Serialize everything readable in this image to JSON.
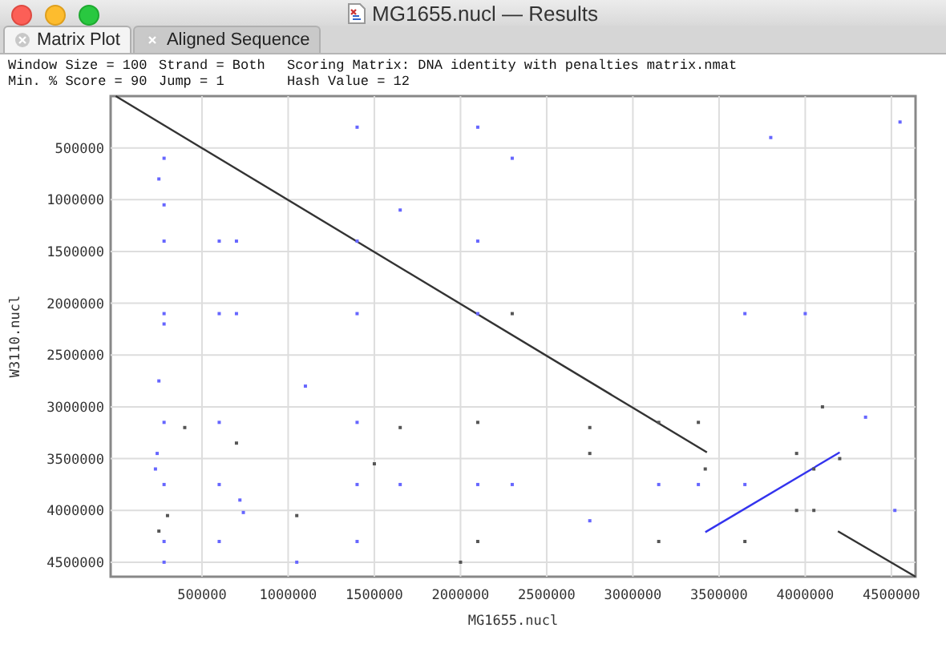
{
  "window": {
    "title": "MG1655.nucl — Results"
  },
  "tabs": [
    {
      "label": "Matrix Plot",
      "selected": true
    },
    {
      "label": "Aligned Sequence",
      "selected": false
    }
  ],
  "info": [
    {
      "text": "Window Size = 100"
    },
    {
      "text": "Strand = Both"
    },
    {
      "text": "Scoring Matrix: DNA identity with penalties matrix.nmat"
    },
    {
      "text": "Min. % Score = 90"
    },
    {
      "text": "Jump = 1"
    },
    {
      "text": "Hash Value = 12"
    }
  ],
  "chart_data": {
    "type": "line",
    "xlabel": "MG1655.nucl",
    "ylabel": "W3110.nucl",
    "xlim": [
      -30000,
      4640000
    ],
    "grid": true,
    "ylim": [
      4640000,
      0
    ],
    "xticks": [
      500000,
      1000000,
      1500000,
      2000000,
      2500000,
      3000000,
      3500000,
      4000000,
      4500000
    ],
    "yticks": [
      500000,
      1000000,
      1500000,
      2000000,
      2500000,
      3000000,
      3500000,
      4000000,
      4500000
    ],
    "series": [
      {
        "color": "#333333",
        "x": [
          0,
          3430000
        ],
        "values": [
          0,
          3440000
        ]
      },
      {
        "color": "#333333",
        "x": [
          4190000,
          4640000
        ],
        "values": [
          4200000,
          4640000
        ]
      },
      {
        "color": "#3333ee",
        "x": [
          3420000,
          4200000
        ],
        "values": [
          4210000,
          3440000
        ]
      },
      {
        "type": "scatter",
        "color": "#6666ff",
        "x": [
          280000,
          250000,
          280000,
          280000,
          280000,
          280000,
          250000,
          280000,
          240000,
          230000,
          280000,
          280000,
          280000,
          600000,
          600000,
          600000,
          720000,
          740000,
          600000,
          700000,
          600000,
          700000,
          1400000,
          1400000,
          1400000,
          1400000,
          1400000,
          1400000,
          1650000,
          1650000,
          1050000,
          1100000,
          2100000,
          2100000,
          2100000,
          2100000,
          2300000,
          2300000,
          2750000,
          3150000,
          3380000,
          3650000,
          3650000,
          4350000,
          4520000,
          4550000,
          3800000,
          4000000
        ],
        "values": [
          600000,
          800000,
          1050000,
          1400000,
          2100000,
          2200000,
          2750000,
          3150000,
          3450000,
          3600000,
          3750000,
          4300000,
          4500000,
          3150000,
          3750000,
          4300000,
          3900000,
          4020000,
          1400000,
          1400000,
          2100000,
          2100000,
          300000,
          1400000,
          2100000,
          3150000,
          3750000,
          4300000,
          1100000,
          3750000,
          4500000,
          2800000,
          300000,
          1400000,
          2100000,
          3750000,
          600000,
          3750000,
          4100000,
          3750000,
          3750000,
          2100000,
          3750000,
          3100000,
          4000000,
          250000,
          400000,
          2100000
        ]
      },
      {
        "type": "scatter",
        "color": "#555555",
        "x": [
          250000,
          300000,
          400000,
          700000,
          1500000,
          1650000,
          2100000,
          2100000,
          2300000,
          2750000,
          2750000,
          3150000,
          3150000,
          3380000,
          3420000,
          3650000,
          3950000,
          4050000,
          4200000,
          3950000,
          4050000,
          4100000,
          1050000,
          2000000
        ],
        "values": [
          4200000,
          4050000,
          3200000,
          3350000,
          3550000,
          3200000,
          3150000,
          4300000,
          2100000,
          3200000,
          3450000,
          3150000,
          4300000,
          3150000,
          3600000,
          4300000,
          3450000,
          3600000,
          3500000,
          4000000,
          4000000,
          3000000,
          4050000,
          4500000
        ]
      }
    ]
  }
}
